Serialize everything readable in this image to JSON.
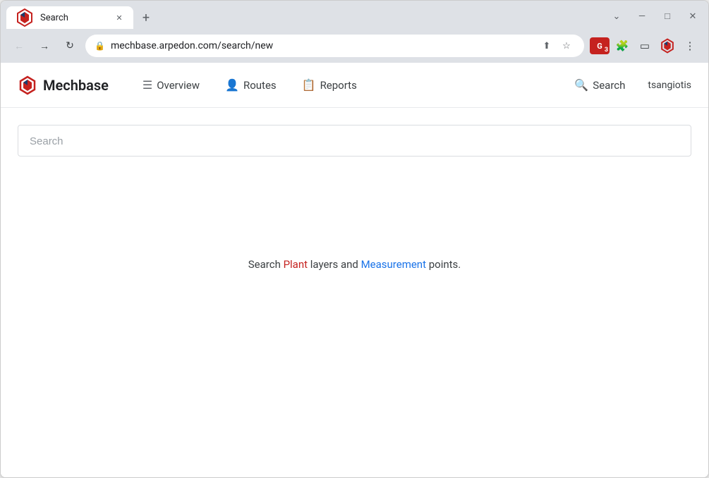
{
  "browser": {
    "tab_title": "Search",
    "tab_favicon": "M",
    "url": "mechbase.arpedon.com/search/new",
    "window_controls": {
      "minimize": "—",
      "maximize": "□",
      "close": "✕",
      "chevron_down": "⌄"
    }
  },
  "app": {
    "logo_text": "Mechbase",
    "nav": {
      "overview_label": "Overview",
      "routes_label": "Routes",
      "reports_label": "Reports",
      "search_label": "Search",
      "user_name": "tsangiotis"
    },
    "search_page": {
      "input_placeholder": "Search",
      "empty_state_text": "Search Plant layers and Measurement points."
    }
  }
}
